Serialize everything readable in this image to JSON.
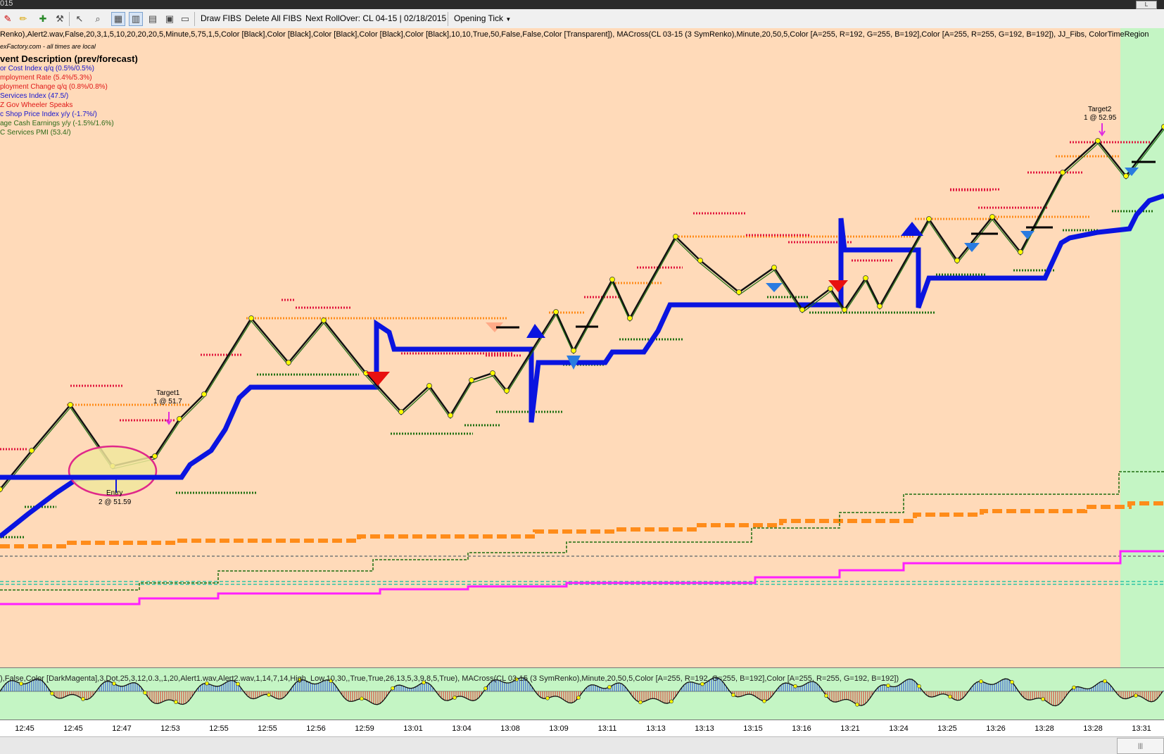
{
  "window": {
    "title": "015",
    "min_button": "L"
  },
  "toolbar": {
    "icons": [
      "pen-icon",
      "pencil-icon",
      "add-indicator-icon",
      "strategy-icon",
      "pointer-icon",
      "zoom-icon",
      "data-box-icon",
      "bar-chart-icon",
      "line-chart-icon",
      "properties-icon",
      "window-icon"
    ],
    "draw_fibs": "Draw FIBS",
    "delete_fibs": "Delete All FIBS",
    "next_rollover": "Next RollOver:  CL 04-15 | 02/18/2015",
    "opening_tick": "Opening Tick"
  },
  "chart": {
    "indicator_params": "Renko),Alert2.wav,False,20,3,1,5,10,20,20,20,5,Minute,5,75,1,5,Color [Black],Color [Black],Color [Black],Color [Black],Color [Black],10,10,True,50,False,False,Color [Transparent]), MACross(CL 03-15 (3 SymRenko),Minute,20,50,5,Color [A=255, R=192, G=255, B=192],Color [A=255, R=255, G=192, B=192]), JJ_Fibs, ColorTimeRegion",
    "forexfactory_note": "exFactory.com - all times are local",
    "event_header": "vent  Description (prev/forecast)",
    "events": [
      {
        "text": "or Cost Index q/q (0.5%/0.5%)",
        "color": "#1515d0"
      },
      {
        "text": "mployment Rate (5.4%/5.3%)",
        "color": "#e01818"
      },
      {
        "text": "ployment Change q/q (0.8%/0.8%)",
        "color": "#e01818"
      },
      {
        "text": " Services Index (47.5/)",
        "color": "#1515d0"
      },
      {
        "text": "Z Gov Wheeler Speaks",
        "color": "#e01818"
      },
      {
        "text": "c Shop Price Index y/y (-1.7%/)",
        "color": "#1515d0"
      },
      {
        "text": "age Cash Earnings y/y (-1.5%/1.6%)",
        "color": "#2c6b1a"
      },
      {
        "text": "C Services PMI (53.4/)",
        "color": "#2c6b1a"
      }
    ],
    "annotations": {
      "target1_label": "Target1",
      "target1_value": "1 @ 51.7",
      "target2_label": "Target2",
      "target2_value": "1 @ 52.95",
      "entry_label": "Entry",
      "entry_value": "2 @ 51.59"
    },
    "colors": {
      "background": "#ffdab9",
      "region": "#c4f5c4",
      "ma_line": "#0a14e0",
      "fib_orange": "#ff8c1a",
      "magenta": "#ff1fff",
      "fib_red": "#e0143c",
      "fib_green": "#1e6e10"
    }
  },
  "oscillator": {
    "params": "),False,Color [DarkMagenta],3,Dot,25,3,12,0.3,,1,20,Alert1.wav,Alert2.wav,1,14,7,14,High_Low,10,30,,True,True,26,13,5,3,9,8,5,True), MACross(CL 03-15 (3 SymRenko),Minute,20,50,5,Color [A=255, R=192, G=255, B=192],Color [A=255, R=255, G=192, B=192])"
  },
  "time_axis": {
    "labels": [
      "12:45",
      "12:45",
      "12:47",
      "12:53",
      "12:55",
      "12:55",
      "12:56",
      "12:59",
      "13:01",
      "13:04",
      "13:08",
      "13:09",
      "13:11",
      "13:13",
      "13:13",
      "13:15",
      "13:16",
      "13:21",
      "13:24",
      "13:25",
      "13:26",
      "13:28",
      "13:28",
      "13:31"
    ]
  },
  "scrollbar": {
    "thumb_label": "|||"
  }
}
